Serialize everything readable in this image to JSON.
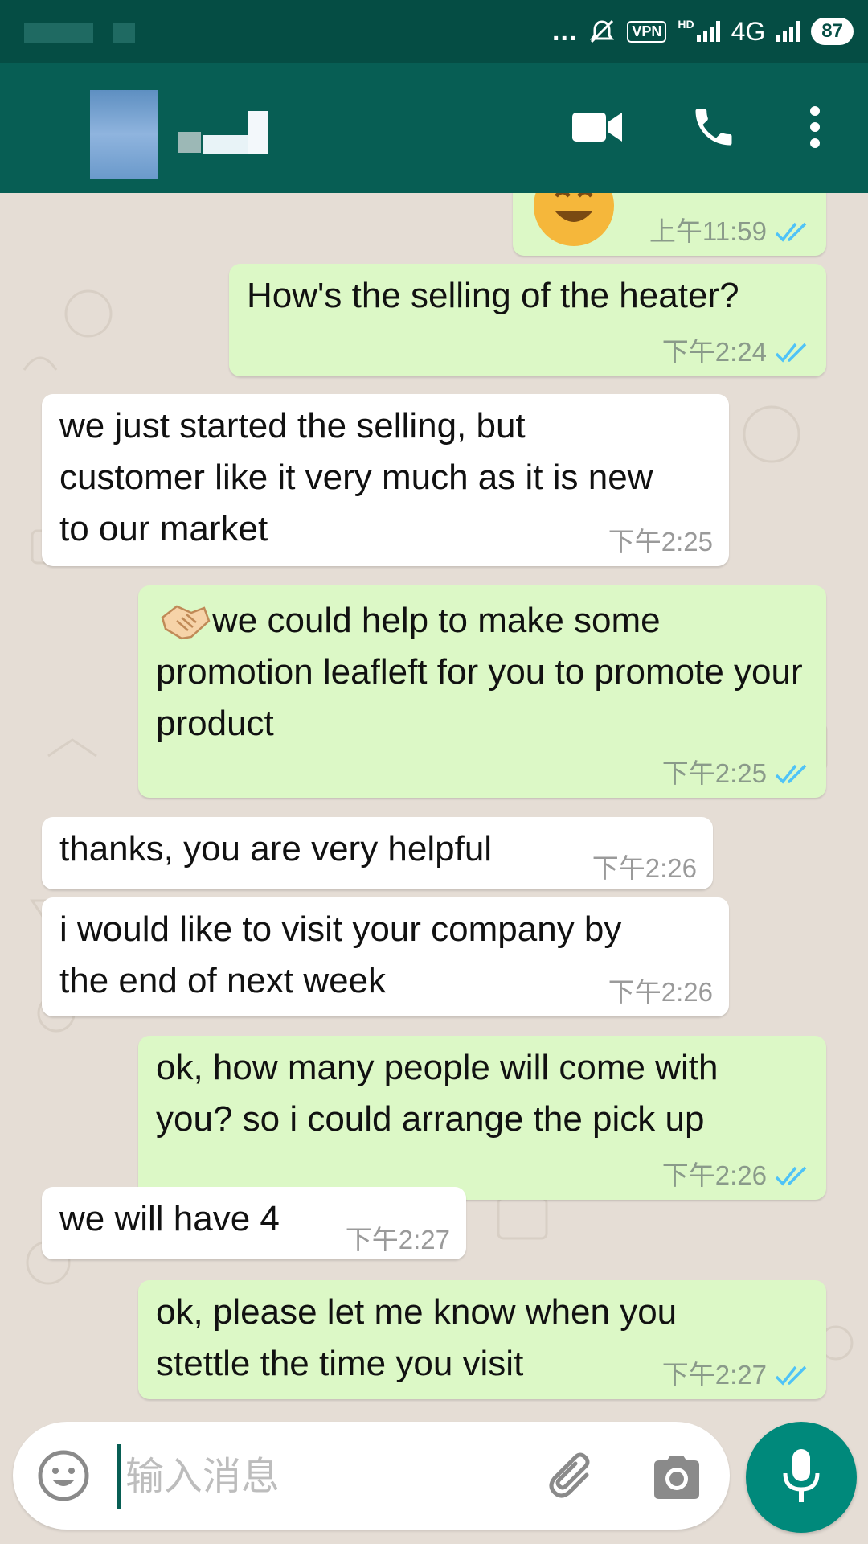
{
  "status_bar": {
    "dots": "...",
    "vpn": "VPN",
    "hd": "HD",
    "network": "4G",
    "battery": "87"
  },
  "header": {
    "icons": [
      "video-call-icon",
      "phone-icon",
      "more-vert-icon"
    ]
  },
  "messages": [
    {
      "dir": "out",
      "text": "",
      "time": "上午11:59",
      "ticks": true,
      "emoji": "smiling-face"
    },
    {
      "dir": "out",
      "text": "How's the selling of the heater?",
      "time": "下午2:24",
      "ticks": true
    },
    {
      "dir": "in",
      "text": "we just started the selling, but customer like it very much as it is new to our market",
      "time": "下午2:25"
    },
    {
      "dir": "out",
      "text": "we could help to make some promotion leafleft for you to promote your product",
      "time": "下午2:25",
      "ticks": true,
      "emoji": "handshake"
    },
    {
      "dir": "in",
      "text": "thanks, you are very helpful",
      "time": "下午2:26"
    },
    {
      "dir": "in",
      "text": "i would like to visit your company by the end of next week",
      "time": "下午2:26"
    },
    {
      "dir": "out",
      "text": "ok, how many people will come with you? so i could arrange the pick up",
      "time": "下午2:26",
      "ticks": true
    },
    {
      "dir": "in",
      "text": "we will have 4",
      "time": "下午2:27"
    },
    {
      "dir": "out",
      "text": "ok, please let me know when you stettle the time you visit",
      "time": "下午2:27",
      "ticks": true
    }
  ],
  "composer": {
    "placeholder": "输入消息",
    "icons": [
      "emoji-icon",
      "attach-icon",
      "camera-icon",
      "mic-icon"
    ]
  },
  "colors": {
    "header": "#075e54",
    "statusbar": "#054d44",
    "outgoing": "#dcf8c6",
    "incoming": "#ffffff",
    "read_ticks": "#4fc3f7",
    "mic": "#00897b"
  }
}
